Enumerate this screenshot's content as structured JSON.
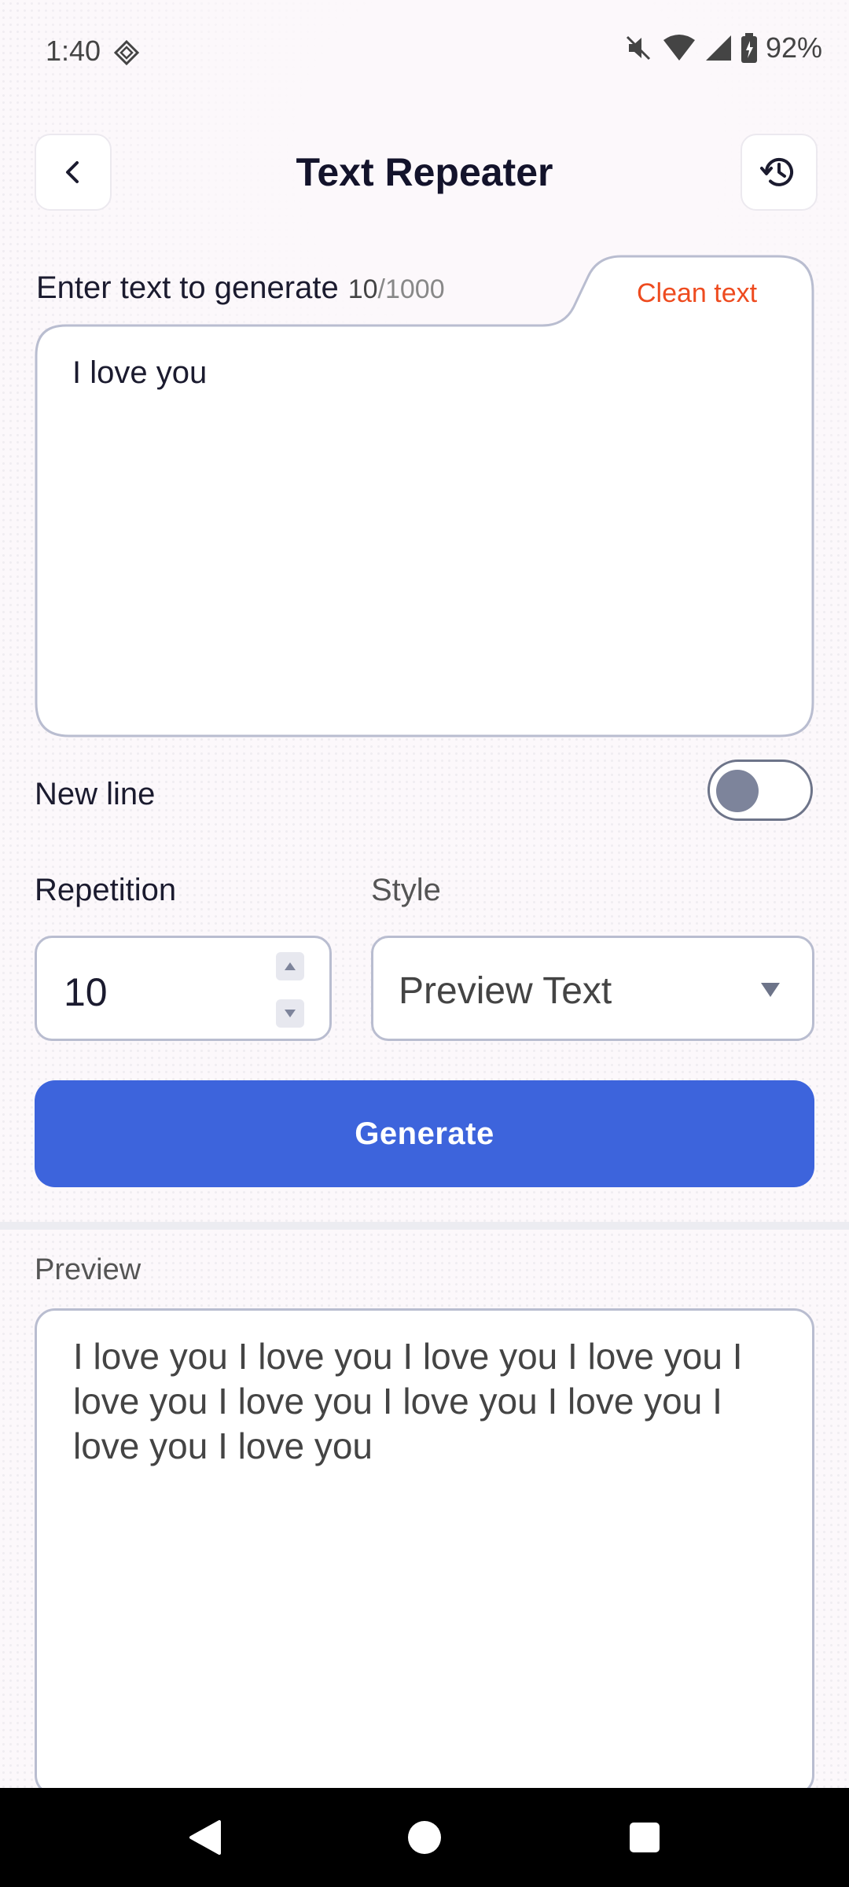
{
  "status_bar": {
    "time": "1:40",
    "battery": "92%",
    "icons": [
      "sim-icon",
      "mute-icon",
      "wifi-icon",
      "signal-icon",
      "battery-icon"
    ]
  },
  "header": {
    "title": "Text Repeater",
    "back_icon": "chevron-left-icon",
    "history_icon": "history-icon"
  },
  "input": {
    "label": "Enter text to generate",
    "count": "10",
    "max": "/1000",
    "clean_label": "Clean text",
    "value": "I love you"
  },
  "new_line": {
    "label": "New line",
    "enabled": false
  },
  "repetition": {
    "label": "Repetition",
    "value": "10"
  },
  "style": {
    "label": "Style",
    "value": "Preview Text"
  },
  "generate": {
    "label": "Generate"
  },
  "preview": {
    "label": "Preview",
    "text": "I love you I love you I love you I love you I love you I love you I love you I love you I love you I love you"
  },
  "colors": {
    "accent": "#3d64dc",
    "clean": "#ee4b1f",
    "border": "#b9bdd0"
  }
}
